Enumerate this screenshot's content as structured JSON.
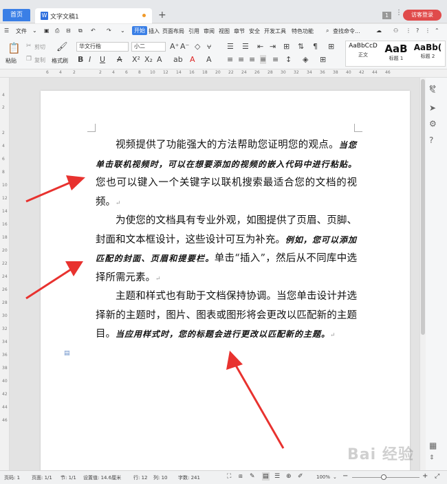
{
  "titlebar": {
    "home_tab": "首页",
    "doc_tab": "文字文稿1",
    "doc_icon": "W",
    "new_tab": "+",
    "page_badge": "1",
    "visitor_login": "访客登录"
  },
  "menubar": {
    "file": "文件",
    "items": [
      "开始",
      "插入",
      "页面布局",
      "引用",
      "审阅",
      "视图",
      "章节",
      "安全",
      "开发工具",
      "特色功能"
    ],
    "search": "查找命令..."
  },
  "ribbon": {
    "paste": "粘贴",
    "cut": "剪切",
    "copy": "复制",
    "format_painter": "格式刷",
    "font_name": "华文行楷",
    "font_size": "小二",
    "styles": [
      {
        "preview": "AaBbCcD",
        "name": "正文"
      },
      {
        "preview": "AaB",
        "name": "标题 1"
      },
      {
        "preview": "AaBb(",
        "name": "标题 2"
      }
    ]
  },
  "ruler": {
    "h_ticks": [
      "6",
      "4",
      "2",
      "2",
      "4",
      "6",
      "8",
      "10",
      "12",
      "14",
      "16",
      "18",
      "20",
      "22",
      "24",
      "26",
      "28",
      "30",
      "32",
      "34",
      "36",
      "38",
      "40",
      "42",
      "44",
      "46"
    ],
    "v_ticks": [
      "4",
      "2",
      "2",
      "4",
      "6",
      "8",
      "10",
      "12",
      "14",
      "16",
      "18",
      "20",
      "22",
      "24",
      "26",
      "28",
      "30",
      "32",
      "34",
      "36",
      "38",
      "40",
      "42",
      "44",
      "46"
    ]
  },
  "document": {
    "p1_normal_a": "视频提供了功能强大的方法帮助您证明您的观点。",
    "p1_calli": "当您单击联机视频时，可以在想要添加的视频的嵌入代码中进行粘贴。",
    "p1_normal_b": "您也可以键入一个关键字以联机搜索最适合您的文档的视频。",
    "p2_normal_a": "为使您的文档具有专业外观，如图提供了页眉、页脚、封面和文本框设计，这些设计可互为补充。",
    "p2_calli": "例如，您可以添加匹配的封面、页眉和提要栏。",
    "p2_normal_b": "单击“插入”，然后从不同库中选择所需元素。",
    "p3_normal": "主题和样式也有助于文档保持协调。当您单击设计并选择新的主题时，图片、图表或图形将会更改以匹配新的主题目。",
    "p3_calli": "当应用样式时，您的标题会进行更改以匹配新的主题。",
    "para_mark": "↵"
  },
  "statusbar": {
    "page_no": "页码: 1",
    "pages": "页面: 1/1",
    "section": "节: 1/1",
    "setting": "设置值: 14.6厘米",
    "row": "行: 12",
    "col": "列: 10",
    "words": "字数: 241",
    "zoom": "100%"
  },
  "watermark": "Bai 经验",
  "colors": {
    "accent": "#3a7fe6",
    "visitor": "#e04b4b",
    "arrow": "#e8322f"
  }
}
